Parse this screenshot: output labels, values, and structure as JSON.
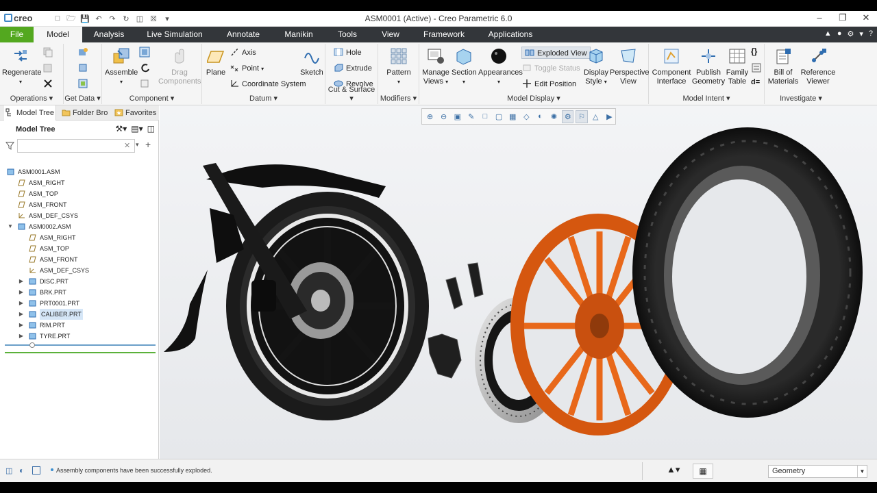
{
  "app": {
    "logo": "creo",
    "window_title": "ASM0001 (Active) - Creo Parametric 6.0",
    "window_controls": [
      "–",
      "❐",
      "✕"
    ]
  },
  "tabs": [
    "File",
    "Model",
    "Analysis",
    "Live Simulation",
    "Annotate",
    "Manikin",
    "Tools",
    "View",
    "Framework",
    "Applications"
  ],
  "ribbon": {
    "operations": {
      "label": "Operations",
      "regenerate": "Regenerate"
    },
    "get_data": {
      "label": "Get Data"
    },
    "component": {
      "label": "Component",
      "assemble": "Assemble",
      "drag": "Drag Components"
    },
    "datum": {
      "label": "Datum",
      "plane": "Plane",
      "axis": "Axis",
      "point": "Point",
      "csys": "Coordinate System",
      "sketch": "Sketch"
    },
    "cut_surface": {
      "label": "Cut & Surface",
      "hole": "Hole",
      "extrude": "Extrude",
      "revolve": "Revolve"
    },
    "modifiers": {
      "label": "Modifiers",
      "pattern": "Pattern"
    },
    "model_display": {
      "label": "Model Display",
      "manage_views": "Manage Views",
      "section": "Section",
      "appearances": "Appearances",
      "exploded_view": "Exploded View",
      "toggle_status": "Toggle Status",
      "edit_position": "Edit Position",
      "display_style": "Display Style",
      "perspective_view": "Perspective View"
    },
    "model_intent": {
      "label": "Model Intent",
      "component_interface": "Component Interface",
      "publish_geometry": "Publish Geometry",
      "family_table": "Family Table"
    },
    "investigate": {
      "label": "Investigate",
      "bom": "Bill of Materials",
      "reference_viewer": "Reference Viewer"
    }
  },
  "left_panel": {
    "tabs": [
      "Model Tree",
      "Folder Bro",
      "Favorites"
    ],
    "title": "Model Tree",
    "filter_placeholder": "",
    "tree": [
      {
        "label": "ASM0001.ASM",
        "level": 0,
        "type": "asm",
        "expander": ""
      },
      {
        "label": "ASM_RIGHT",
        "level": 1,
        "type": "plane",
        "expander": ""
      },
      {
        "label": "ASM_TOP",
        "level": 1,
        "type": "plane",
        "expander": ""
      },
      {
        "label": "ASM_FRONT",
        "level": 1,
        "type": "plane",
        "expander": ""
      },
      {
        "label": "ASM_DEF_CSYS",
        "level": 1,
        "type": "csys",
        "expander": ""
      },
      {
        "label": "ASM0002.ASM",
        "level": 1,
        "type": "asm",
        "expander": "▼"
      },
      {
        "label": "ASM_RIGHT",
        "level": 2,
        "type": "plane",
        "expander": ""
      },
      {
        "label": "ASM_TOP",
        "level": 2,
        "type": "plane",
        "expander": ""
      },
      {
        "label": "ASM_FRONT",
        "level": 2,
        "type": "plane",
        "expander": ""
      },
      {
        "label": "ASM_DEF_CSYS",
        "level": 2,
        "type": "csys",
        "expander": ""
      },
      {
        "label": "DISC.PRT",
        "level": 2,
        "type": "part",
        "expander": "▶"
      },
      {
        "label": "BRK.PRT",
        "level": 2,
        "type": "part",
        "expander": "▶"
      },
      {
        "label": "PRT0001.PRT",
        "level": 2,
        "type": "part",
        "expander": "▶"
      },
      {
        "label": "CALIBER.PRT",
        "level": 2,
        "type": "part",
        "expander": "▶",
        "highlighted": true
      },
      {
        "label": "RIM.PRT",
        "level": 2,
        "type": "part",
        "expander": "▶"
      },
      {
        "label": "TYRE.PRT",
        "level": 2,
        "type": "part",
        "expander": "▶"
      }
    ]
  },
  "status": {
    "message": "Assembly components have been successfully exploded.",
    "selection_filter": "Geometry"
  },
  "colors": {
    "file_tab": "#53a81f",
    "rim": "#e8681a",
    "tab_bar": "#33363a",
    "selection": "#d5e6f7"
  }
}
